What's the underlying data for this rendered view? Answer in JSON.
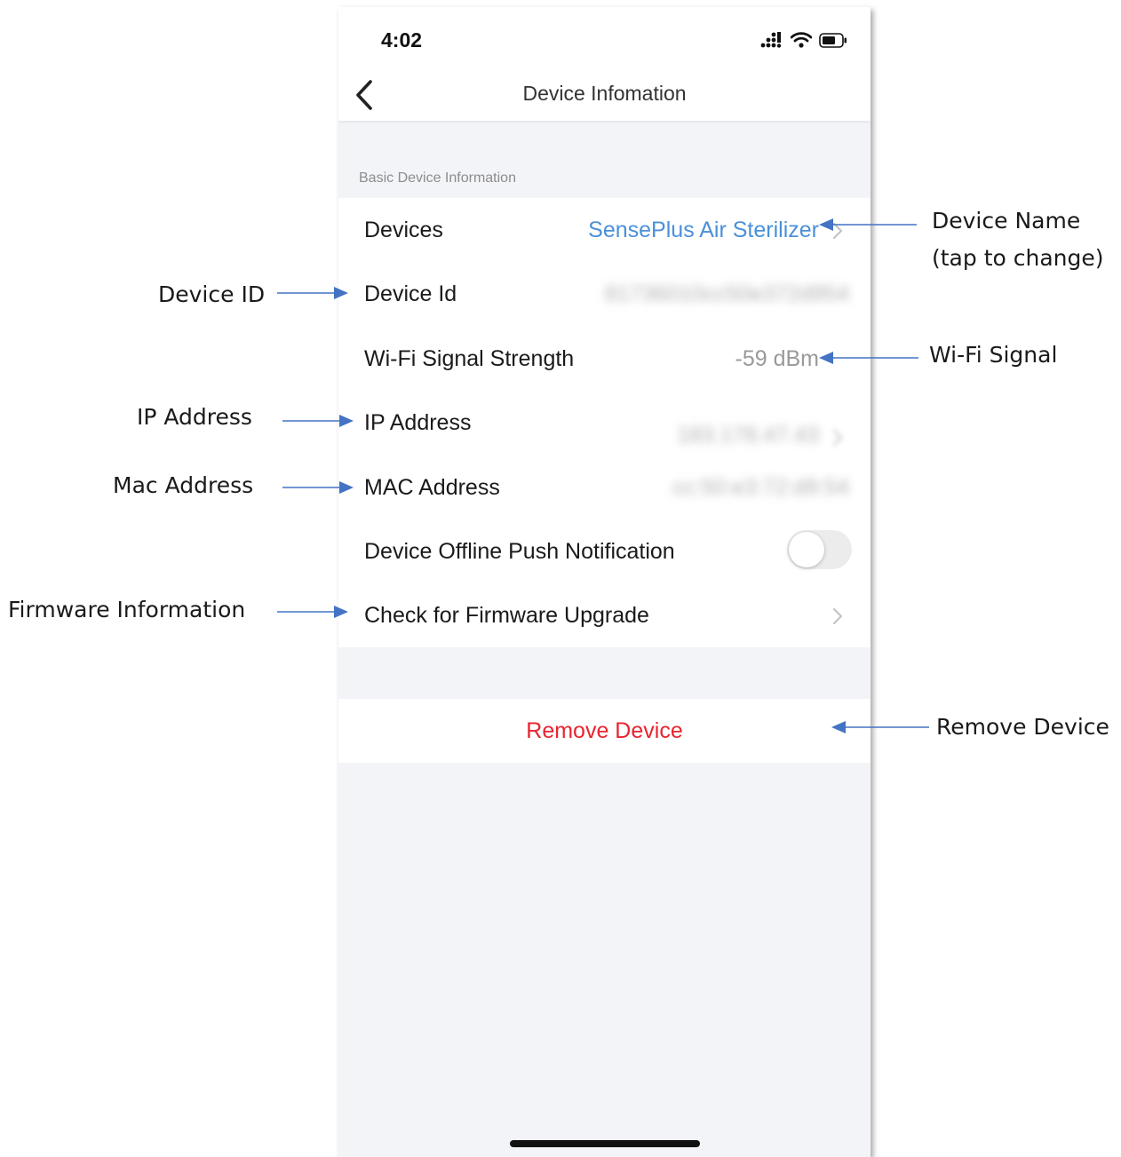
{
  "status_bar": {
    "time": "4:02",
    "icons": [
      "cellular-icon",
      "wifi-icon",
      "battery-icon"
    ]
  },
  "nav": {
    "title": "Device Infomation",
    "back_icon": "chevron-left-icon"
  },
  "section": {
    "label": "Basic Device Information"
  },
  "rows": {
    "devices": {
      "label": "Devices",
      "value": "SensePlus Air Sterilizer"
    },
    "device_id": {
      "label": "Device Id",
      "value": "81736010cc50e372d954"
    },
    "wifi": {
      "label": "Wi-Fi Signal Strength",
      "value": "-59 dBm"
    },
    "ip": {
      "label": "IP Address",
      "value": "183.178.47.43"
    },
    "mac": {
      "label": "MAC Address",
      "value": "cc:50:e3:72:d9:54"
    },
    "offline_push": {
      "label": "Device Offline Push Notification",
      "toggle_on": false
    },
    "firmware": {
      "label": "Check for Firmware Upgrade"
    }
  },
  "remove_button": {
    "label": "Remove Device"
  },
  "annotations": {
    "device_name_line1": "Device Name",
    "device_name_line2": "(tap to change)",
    "device_id": "Device ID",
    "wifi_signal": "Wi-Fi Signal",
    "ip_address": "IP Address",
    "mac_address": "Mac Address",
    "firmware_info": "Firmware Information",
    "remove_device": "Remove Device"
  },
  "colors": {
    "accent_blue": "#4a90d9",
    "danger_red": "#e8242f",
    "arrow": "#4472c4",
    "page_bg": "#f3f4f8"
  }
}
